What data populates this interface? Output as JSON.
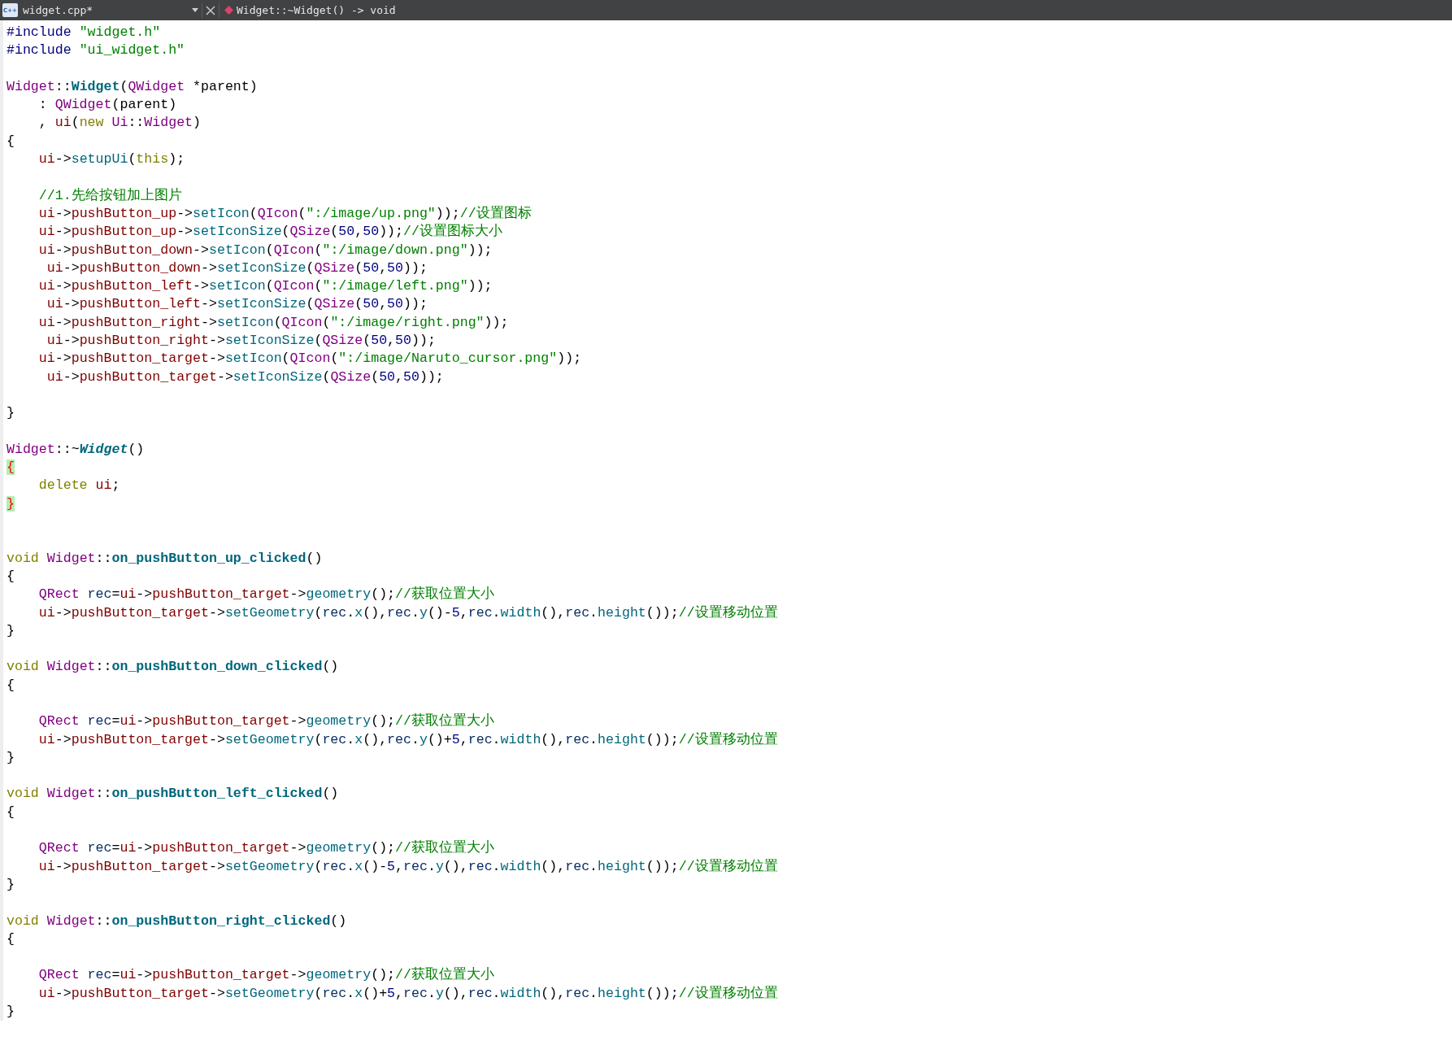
{
  "toolbar": {
    "file_icon_text": "C++",
    "file_name": "widget.cpp*",
    "symbol": "Widget::~Widget() -> void"
  },
  "editor": {
    "lines": [
      {
        "kind": "code",
        "tokens": [
          {
            "kind": "preproc",
            "text": "#include"
          },
          {
            "kind": "string",
            "text": " \"widget.h\""
          }
        ]
      },
      {
        "kind": "code",
        "tokens": [
          {
            "kind": "preproc",
            "text": "#include"
          },
          {
            "kind": "string",
            "text": " \"ui_widget.h\""
          }
        ]
      },
      {
        "kind": "blank"
      },
      {
        "kind": "code",
        "tokens": [
          {
            "kind": "type",
            "text": "Widget"
          },
          {
            "kind": "plain",
            "text": "::"
          },
          {
            "kind": "decl",
            "text": "Widget"
          },
          {
            "kind": "plain",
            "text": "("
          },
          {
            "kind": "type",
            "text": "QWidget"
          },
          {
            "kind": "plain",
            "text": " *parent)"
          }
        ]
      },
      {
        "kind": "code",
        "tokens": [
          {
            "kind": "plain",
            "text": "    : "
          },
          {
            "kind": "type",
            "text": "QWidget"
          },
          {
            "kind": "plain",
            "text": "(parent)"
          }
        ]
      },
      {
        "kind": "code",
        "tokens": [
          {
            "kind": "plain",
            "text": "    , "
          },
          {
            "kind": "member",
            "text": "ui"
          },
          {
            "kind": "plain",
            "text": "("
          },
          {
            "kind": "keyword",
            "text": "new"
          },
          {
            "kind": "type",
            "text": " Ui"
          },
          {
            "kind": "plain",
            "text": "::"
          },
          {
            "kind": "type",
            "text": "Widget"
          },
          {
            "kind": "plain",
            "text": ")"
          }
        ]
      },
      {
        "kind": "code",
        "tokens": [
          {
            "kind": "plain",
            "text": "{"
          }
        ]
      },
      {
        "kind": "code",
        "tokens": [
          {
            "kind": "member",
            "text": "    ui"
          },
          {
            "kind": "plain",
            "text": "->"
          },
          {
            "kind": "call",
            "text": "setupUi"
          },
          {
            "kind": "plain",
            "text": "("
          },
          {
            "kind": "keyword",
            "text": "this"
          },
          {
            "kind": "plain",
            "text": ");"
          }
        ]
      },
      {
        "kind": "blank"
      },
      {
        "kind": "code",
        "tokens": [
          {
            "kind": "comment",
            "text": "    //1.先给按钮加上图片"
          }
        ]
      },
      {
        "kind": "code",
        "tokens": [
          {
            "kind": "member",
            "text": "    ui"
          },
          {
            "kind": "plain",
            "text": "->"
          },
          {
            "kind": "member",
            "text": "pushButton_up"
          },
          {
            "kind": "plain",
            "text": "->"
          },
          {
            "kind": "call",
            "text": "setIcon"
          },
          {
            "kind": "plain",
            "text": "("
          },
          {
            "kind": "type",
            "text": "QIcon"
          },
          {
            "kind": "plain",
            "text": "("
          },
          {
            "kind": "string",
            "text": "\":/image/up.png\""
          },
          {
            "kind": "plain",
            "text": "));"
          },
          {
            "kind": "comment",
            "text": "//设置图标"
          }
        ]
      },
      {
        "kind": "code",
        "tokens": [
          {
            "kind": "member",
            "text": "    ui"
          },
          {
            "kind": "plain",
            "text": "->"
          },
          {
            "kind": "member",
            "text": "pushButton_up"
          },
          {
            "kind": "plain",
            "text": "->"
          },
          {
            "kind": "call",
            "text": "setIconSize"
          },
          {
            "kind": "plain",
            "text": "("
          },
          {
            "kind": "type",
            "text": "QSize"
          },
          {
            "kind": "plain",
            "text": "("
          },
          {
            "kind": "number",
            "text": "50"
          },
          {
            "kind": "plain",
            "text": ","
          },
          {
            "kind": "number",
            "text": "50"
          },
          {
            "kind": "plain",
            "text": "));"
          },
          {
            "kind": "comment",
            "text": "//设置图标大小"
          }
        ]
      },
      {
        "kind": "code",
        "tokens": [
          {
            "kind": "member",
            "text": "    ui"
          },
          {
            "kind": "plain",
            "text": "->"
          },
          {
            "kind": "member",
            "text": "pushButton_down"
          },
          {
            "kind": "plain",
            "text": "->"
          },
          {
            "kind": "call",
            "text": "setIcon"
          },
          {
            "kind": "plain",
            "text": "("
          },
          {
            "kind": "type",
            "text": "QIcon"
          },
          {
            "kind": "plain",
            "text": "("
          },
          {
            "kind": "string",
            "text": "\":/image/down.png\""
          },
          {
            "kind": "plain",
            "text": "));"
          }
        ]
      },
      {
        "kind": "code",
        "tokens": [
          {
            "kind": "member",
            "text": "     ui"
          },
          {
            "kind": "plain",
            "text": "->"
          },
          {
            "kind": "member",
            "text": "pushButton_down"
          },
          {
            "kind": "plain",
            "text": "->"
          },
          {
            "kind": "call",
            "text": "setIconSize"
          },
          {
            "kind": "plain",
            "text": "("
          },
          {
            "kind": "type",
            "text": "QSize"
          },
          {
            "kind": "plain",
            "text": "("
          },
          {
            "kind": "number",
            "text": "50"
          },
          {
            "kind": "plain",
            "text": ","
          },
          {
            "kind": "number",
            "text": "50"
          },
          {
            "kind": "plain",
            "text": "));"
          }
        ]
      },
      {
        "kind": "code",
        "tokens": [
          {
            "kind": "member",
            "text": "    ui"
          },
          {
            "kind": "plain",
            "text": "->"
          },
          {
            "kind": "member",
            "text": "pushButton_left"
          },
          {
            "kind": "plain",
            "text": "->"
          },
          {
            "kind": "call",
            "text": "setIcon"
          },
          {
            "kind": "plain",
            "text": "("
          },
          {
            "kind": "type",
            "text": "QIcon"
          },
          {
            "kind": "plain",
            "text": "("
          },
          {
            "kind": "string",
            "text": "\":/image/left.png\""
          },
          {
            "kind": "plain",
            "text": "));"
          }
        ]
      },
      {
        "kind": "code",
        "tokens": [
          {
            "kind": "member",
            "text": "     ui"
          },
          {
            "kind": "plain",
            "text": "->"
          },
          {
            "kind": "member",
            "text": "pushButton_left"
          },
          {
            "kind": "plain",
            "text": "->"
          },
          {
            "kind": "call",
            "text": "setIconSize"
          },
          {
            "kind": "plain",
            "text": "("
          },
          {
            "kind": "type",
            "text": "QSize"
          },
          {
            "kind": "plain",
            "text": "("
          },
          {
            "kind": "number",
            "text": "50"
          },
          {
            "kind": "plain",
            "text": ","
          },
          {
            "kind": "number",
            "text": "50"
          },
          {
            "kind": "plain",
            "text": "));"
          }
        ]
      },
      {
        "kind": "code",
        "tokens": [
          {
            "kind": "member",
            "text": "    ui"
          },
          {
            "kind": "plain",
            "text": "->"
          },
          {
            "kind": "member",
            "text": "pushButton_right"
          },
          {
            "kind": "plain",
            "text": "->"
          },
          {
            "kind": "call",
            "text": "setIcon"
          },
          {
            "kind": "plain",
            "text": "("
          },
          {
            "kind": "type",
            "text": "QIcon"
          },
          {
            "kind": "plain",
            "text": "("
          },
          {
            "kind": "string",
            "text": "\":/image/right.png\""
          },
          {
            "kind": "plain",
            "text": "));"
          }
        ]
      },
      {
        "kind": "code",
        "tokens": [
          {
            "kind": "member",
            "text": "     ui"
          },
          {
            "kind": "plain",
            "text": "->"
          },
          {
            "kind": "member",
            "text": "pushButton_right"
          },
          {
            "kind": "plain",
            "text": "->"
          },
          {
            "kind": "call",
            "text": "setIconSize"
          },
          {
            "kind": "plain",
            "text": "("
          },
          {
            "kind": "type",
            "text": "QSize"
          },
          {
            "kind": "plain",
            "text": "("
          },
          {
            "kind": "number",
            "text": "50"
          },
          {
            "kind": "plain",
            "text": ","
          },
          {
            "kind": "number",
            "text": "50"
          },
          {
            "kind": "plain",
            "text": "));"
          }
        ]
      },
      {
        "kind": "code",
        "tokens": [
          {
            "kind": "member",
            "text": "    ui"
          },
          {
            "kind": "plain",
            "text": "->"
          },
          {
            "kind": "member",
            "text": "pushButton_target"
          },
          {
            "kind": "plain",
            "text": "->"
          },
          {
            "kind": "call",
            "text": "setIcon"
          },
          {
            "kind": "plain",
            "text": "("
          },
          {
            "kind": "type",
            "text": "QIcon"
          },
          {
            "kind": "plain",
            "text": "("
          },
          {
            "kind": "string",
            "text": "\":/image/Naruto_cursor.png\""
          },
          {
            "kind": "plain",
            "text": "));"
          }
        ]
      },
      {
        "kind": "code",
        "tokens": [
          {
            "kind": "member",
            "text": "     ui"
          },
          {
            "kind": "plain",
            "text": "->"
          },
          {
            "kind": "member",
            "text": "pushButton_target"
          },
          {
            "kind": "plain",
            "text": "->"
          },
          {
            "kind": "call",
            "text": "setIconSize"
          },
          {
            "kind": "plain",
            "text": "("
          },
          {
            "kind": "type",
            "text": "QSize"
          },
          {
            "kind": "plain",
            "text": "("
          },
          {
            "kind": "number",
            "text": "50"
          },
          {
            "kind": "plain",
            "text": ","
          },
          {
            "kind": "number",
            "text": "50"
          },
          {
            "kind": "plain",
            "text": "));"
          }
        ]
      },
      {
        "kind": "blank"
      },
      {
        "kind": "code",
        "tokens": [
          {
            "kind": "plain",
            "text": "}"
          }
        ]
      },
      {
        "kind": "blank"
      },
      {
        "kind": "code",
        "tokens": [
          {
            "kind": "type",
            "text": "Widget"
          },
          {
            "kind": "plain",
            "text": "::~"
          },
          {
            "kind": "declitalic",
            "text": "Widget"
          },
          {
            "kind": "plain",
            "text": "()"
          }
        ]
      },
      {
        "kind": "code",
        "tokens": [
          {
            "kind": "match",
            "text": "{"
          }
        ]
      },
      {
        "kind": "code",
        "tokens": [
          {
            "kind": "keyword",
            "text": "    delete"
          },
          {
            "kind": "member",
            "text": " ui"
          },
          {
            "kind": "plain",
            "text": ";"
          }
        ]
      },
      {
        "kind": "code",
        "tokens": [
          {
            "kind": "match",
            "text": "}"
          }
        ]
      },
      {
        "kind": "blank"
      },
      {
        "kind": "blank"
      },
      {
        "kind": "code",
        "tokens": [
          {
            "kind": "keyword",
            "text": "void"
          },
          {
            "kind": "type",
            "text": " Widget"
          },
          {
            "kind": "plain",
            "text": "::"
          },
          {
            "kind": "decl",
            "text": "on_pushButton_up_clicked"
          },
          {
            "kind": "plain",
            "text": "()"
          }
        ]
      },
      {
        "kind": "code",
        "tokens": [
          {
            "kind": "plain",
            "text": "{"
          }
        ]
      },
      {
        "kind": "code",
        "tokens": [
          {
            "kind": "type",
            "text": "    QRect"
          },
          {
            "kind": "local",
            "text": " rec"
          },
          {
            "kind": "plain",
            "text": "="
          },
          {
            "kind": "member",
            "text": "ui"
          },
          {
            "kind": "plain",
            "text": "->"
          },
          {
            "kind": "member",
            "text": "pushButton_target"
          },
          {
            "kind": "plain",
            "text": "->"
          },
          {
            "kind": "call",
            "text": "geometry"
          },
          {
            "kind": "plain",
            "text": "();"
          },
          {
            "kind": "comment",
            "text": "//获取位置大小"
          }
        ]
      },
      {
        "kind": "code",
        "tokens": [
          {
            "kind": "member",
            "text": "    ui"
          },
          {
            "kind": "plain",
            "text": "->"
          },
          {
            "kind": "member",
            "text": "pushButton_target"
          },
          {
            "kind": "plain",
            "text": "->"
          },
          {
            "kind": "call",
            "text": "setGeometry"
          },
          {
            "kind": "plain",
            "text": "("
          },
          {
            "kind": "local",
            "text": "rec"
          },
          {
            "kind": "plain",
            "text": "."
          },
          {
            "kind": "call",
            "text": "x"
          },
          {
            "kind": "plain",
            "text": "(),"
          },
          {
            "kind": "local",
            "text": "rec"
          },
          {
            "kind": "plain",
            "text": "."
          },
          {
            "kind": "call",
            "text": "y"
          },
          {
            "kind": "plain",
            "text": "()-"
          },
          {
            "kind": "number",
            "text": "5"
          },
          {
            "kind": "plain",
            "text": ","
          },
          {
            "kind": "local",
            "text": "rec"
          },
          {
            "kind": "plain",
            "text": "."
          },
          {
            "kind": "call",
            "text": "width"
          },
          {
            "kind": "plain",
            "text": "(),"
          },
          {
            "kind": "local",
            "text": "rec"
          },
          {
            "kind": "plain",
            "text": "."
          },
          {
            "kind": "call",
            "text": "height"
          },
          {
            "kind": "plain",
            "text": "());"
          },
          {
            "kind": "comment",
            "text": "//设置移动位置"
          }
        ]
      },
      {
        "kind": "code",
        "tokens": [
          {
            "kind": "plain",
            "text": "}"
          }
        ]
      },
      {
        "kind": "blank"
      },
      {
        "kind": "code",
        "tokens": [
          {
            "kind": "keyword",
            "text": "void"
          },
          {
            "kind": "type",
            "text": " Widget"
          },
          {
            "kind": "plain",
            "text": "::"
          },
          {
            "kind": "decl",
            "text": "on_pushButton_down_clicked"
          },
          {
            "kind": "plain",
            "text": "()"
          }
        ]
      },
      {
        "kind": "code",
        "tokens": [
          {
            "kind": "plain",
            "text": "{"
          }
        ]
      },
      {
        "kind": "blank"
      },
      {
        "kind": "code",
        "tokens": [
          {
            "kind": "type",
            "text": "    QRect"
          },
          {
            "kind": "local",
            "text": " rec"
          },
          {
            "kind": "plain",
            "text": "="
          },
          {
            "kind": "member",
            "text": "ui"
          },
          {
            "kind": "plain",
            "text": "->"
          },
          {
            "kind": "member",
            "text": "pushButton_target"
          },
          {
            "kind": "plain",
            "text": "->"
          },
          {
            "kind": "call",
            "text": "geometry"
          },
          {
            "kind": "plain",
            "text": "();"
          },
          {
            "kind": "comment",
            "text": "//获取位置大小"
          }
        ]
      },
      {
        "kind": "code",
        "tokens": [
          {
            "kind": "member",
            "text": "    ui"
          },
          {
            "kind": "plain",
            "text": "->"
          },
          {
            "kind": "member",
            "text": "pushButton_target"
          },
          {
            "kind": "plain",
            "text": "->"
          },
          {
            "kind": "call",
            "text": "setGeometry"
          },
          {
            "kind": "plain",
            "text": "("
          },
          {
            "kind": "local",
            "text": "rec"
          },
          {
            "kind": "plain",
            "text": "."
          },
          {
            "kind": "call",
            "text": "x"
          },
          {
            "kind": "plain",
            "text": "(),"
          },
          {
            "kind": "local",
            "text": "rec"
          },
          {
            "kind": "plain",
            "text": "."
          },
          {
            "kind": "call",
            "text": "y"
          },
          {
            "kind": "plain",
            "text": "()+"
          },
          {
            "kind": "number",
            "text": "5"
          },
          {
            "kind": "plain",
            "text": ","
          },
          {
            "kind": "local",
            "text": "rec"
          },
          {
            "kind": "plain",
            "text": "."
          },
          {
            "kind": "call",
            "text": "width"
          },
          {
            "kind": "plain",
            "text": "(),"
          },
          {
            "kind": "local",
            "text": "rec"
          },
          {
            "kind": "plain",
            "text": "."
          },
          {
            "kind": "call",
            "text": "height"
          },
          {
            "kind": "plain",
            "text": "());"
          },
          {
            "kind": "comment",
            "text": "//设置移动位置"
          }
        ]
      },
      {
        "kind": "code",
        "tokens": [
          {
            "kind": "plain",
            "text": "}"
          }
        ]
      },
      {
        "kind": "blank"
      },
      {
        "kind": "code",
        "tokens": [
          {
            "kind": "keyword",
            "text": "void"
          },
          {
            "kind": "type",
            "text": " Widget"
          },
          {
            "kind": "plain",
            "text": "::"
          },
          {
            "kind": "decl",
            "text": "on_pushButton_left_clicked"
          },
          {
            "kind": "plain",
            "text": "()"
          }
        ]
      },
      {
        "kind": "code",
        "tokens": [
          {
            "kind": "plain",
            "text": "{"
          }
        ]
      },
      {
        "kind": "blank"
      },
      {
        "kind": "code",
        "tokens": [
          {
            "kind": "type",
            "text": "    QRect"
          },
          {
            "kind": "local",
            "text": " rec"
          },
          {
            "kind": "plain",
            "text": "="
          },
          {
            "kind": "member",
            "text": "ui"
          },
          {
            "kind": "plain",
            "text": "->"
          },
          {
            "kind": "member",
            "text": "pushButton_target"
          },
          {
            "kind": "plain",
            "text": "->"
          },
          {
            "kind": "call",
            "text": "geometry"
          },
          {
            "kind": "plain",
            "text": "();"
          },
          {
            "kind": "comment",
            "text": "//获取位置大小"
          }
        ]
      },
      {
        "kind": "code",
        "tokens": [
          {
            "kind": "member",
            "text": "    ui"
          },
          {
            "kind": "plain",
            "text": "->"
          },
          {
            "kind": "member",
            "text": "pushButton_target"
          },
          {
            "kind": "plain",
            "text": "->"
          },
          {
            "kind": "call",
            "text": "setGeometry"
          },
          {
            "kind": "plain",
            "text": "("
          },
          {
            "kind": "local",
            "text": "rec"
          },
          {
            "kind": "plain",
            "text": "."
          },
          {
            "kind": "call",
            "text": "x"
          },
          {
            "kind": "plain",
            "text": "()-"
          },
          {
            "kind": "number",
            "text": "5"
          },
          {
            "kind": "plain",
            "text": ","
          },
          {
            "kind": "local",
            "text": "rec"
          },
          {
            "kind": "plain",
            "text": "."
          },
          {
            "kind": "call",
            "text": "y"
          },
          {
            "kind": "plain",
            "text": "(),"
          },
          {
            "kind": "local",
            "text": "rec"
          },
          {
            "kind": "plain",
            "text": "."
          },
          {
            "kind": "call",
            "text": "width"
          },
          {
            "kind": "plain",
            "text": "(),"
          },
          {
            "kind": "local",
            "text": "rec"
          },
          {
            "kind": "plain",
            "text": "."
          },
          {
            "kind": "call",
            "text": "height"
          },
          {
            "kind": "plain",
            "text": "());"
          },
          {
            "kind": "comment",
            "text": "//设置移动位置"
          }
        ]
      },
      {
        "kind": "code",
        "tokens": [
          {
            "kind": "plain",
            "text": "}"
          }
        ]
      },
      {
        "kind": "blank"
      },
      {
        "kind": "code",
        "tokens": [
          {
            "kind": "keyword",
            "text": "void"
          },
          {
            "kind": "type",
            "text": " Widget"
          },
          {
            "kind": "plain",
            "text": "::"
          },
          {
            "kind": "decl",
            "text": "on_pushButton_right_clicked"
          },
          {
            "kind": "plain",
            "text": "()"
          }
        ]
      },
      {
        "kind": "code",
        "tokens": [
          {
            "kind": "plain",
            "text": "{"
          }
        ]
      },
      {
        "kind": "blank"
      },
      {
        "kind": "code",
        "tokens": [
          {
            "kind": "type",
            "text": "    QRect"
          },
          {
            "kind": "local",
            "text": " rec"
          },
          {
            "kind": "plain",
            "text": "="
          },
          {
            "kind": "member",
            "text": "ui"
          },
          {
            "kind": "plain",
            "text": "->"
          },
          {
            "kind": "member",
            "text": "pushButton_target"
          },
          {
            "kind": "plain",
            "text": "->"
          },
          {
            "kind": "call",
            "text": "geometry"
          },
          {
            "kind": "plain",
            "text": "();"
          },
          {
            "kind": "comment",
            "text": "//获取位置大小"
          }
        ]
      },
      {
        "kind": "code",
        "tokens": [
          {
            "kind": "member",
            "text": "    ui"
          },
          {
            "kind": "plain",
            "text": "->"
          },
          {
            "kind": "member",
            "text": "pushButton_target"
          },
          {
            "kind": "plain",
            "text": "->"
          },
          {
            "kind": "call",
            "text": "setGeometry"
          },
          {
            "kind": "plain",
            "text": "("
          },
          {
            "kind": "local",
            "text": "rec"
          },
          {
            "kind": "plain",
            "text": "."
          },
          {
            "kind": "call",
            "text": "x"
          },
          {
            "kind": "plain",
            "text": "()+"
          },
          {
            "kind": "number",
            "text": "5"
          },
          {
            "kind": "plain",
            "text": ","
          },
          {
            "kind": "local",
            "text": "rec"
          },
          {
            "kind": "plain",
            "text": "."
          },
          {
            "kind": "call",
            "text": "y"
          },
          {
            "kind": "plain",
            "text": "(),"
          },
          {
            "kind": "local",
            "text": "rec"
          },
          {
            "kind": "plain",
            "text": "."
          },
          {
            "kind": "call",
            "text": "width"
          },
          {
            "kind": "plain",
            "text": "(),"
          },
          {
            "kind": "local",
            "text": "rec"
          },
          {
            "kind": "plain",
            "text": "."
          },
          {
            "kind": "call",
            "text": "height"
          },
          {
            "kind": "plain",
            "text": "());"
          },
          {
            "kind": "comment",
            "text": "//设置移动位置"
          }
        ]
      },
      {
        "kind": "code",
        "tokens": [
          {
            "kind": "plain",
            "text": "}"
          }
        ]
      }
    ]
  }
}
